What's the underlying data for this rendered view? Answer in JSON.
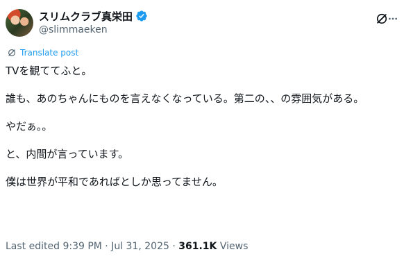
{
  "author": {
    "display_name": "スリムクラブ真栄田",
    "handle": "@slimmaeken"
  },
  "translate_label": "Translate post",
  "post_lines": [
    "TVを観ててふと。",
    "誰も、あのちゃんにものを言えなくなっている。第二の、、の雰囲気がある。",
    "やだぁ。。",
    "と、内間が言っています。",
    "僕は世界が平和であればとしか思ってません。"
  ],
  "meta": {
    "edited": "Last edited 9:39 PM · Jul 31, 2025 · ",
    "views_count": "361.1K",
    "views_label": " Views"
  },
  "colors": {
    "accent": "#1d9bf0",
    "secondary": "#536471",
    "text": "#0f1419"
  },
  "icons": [
    "verified-badge-icon",
    "grok-icon",
    "more-options-icon",
    "translate-icon"
  ]
}
